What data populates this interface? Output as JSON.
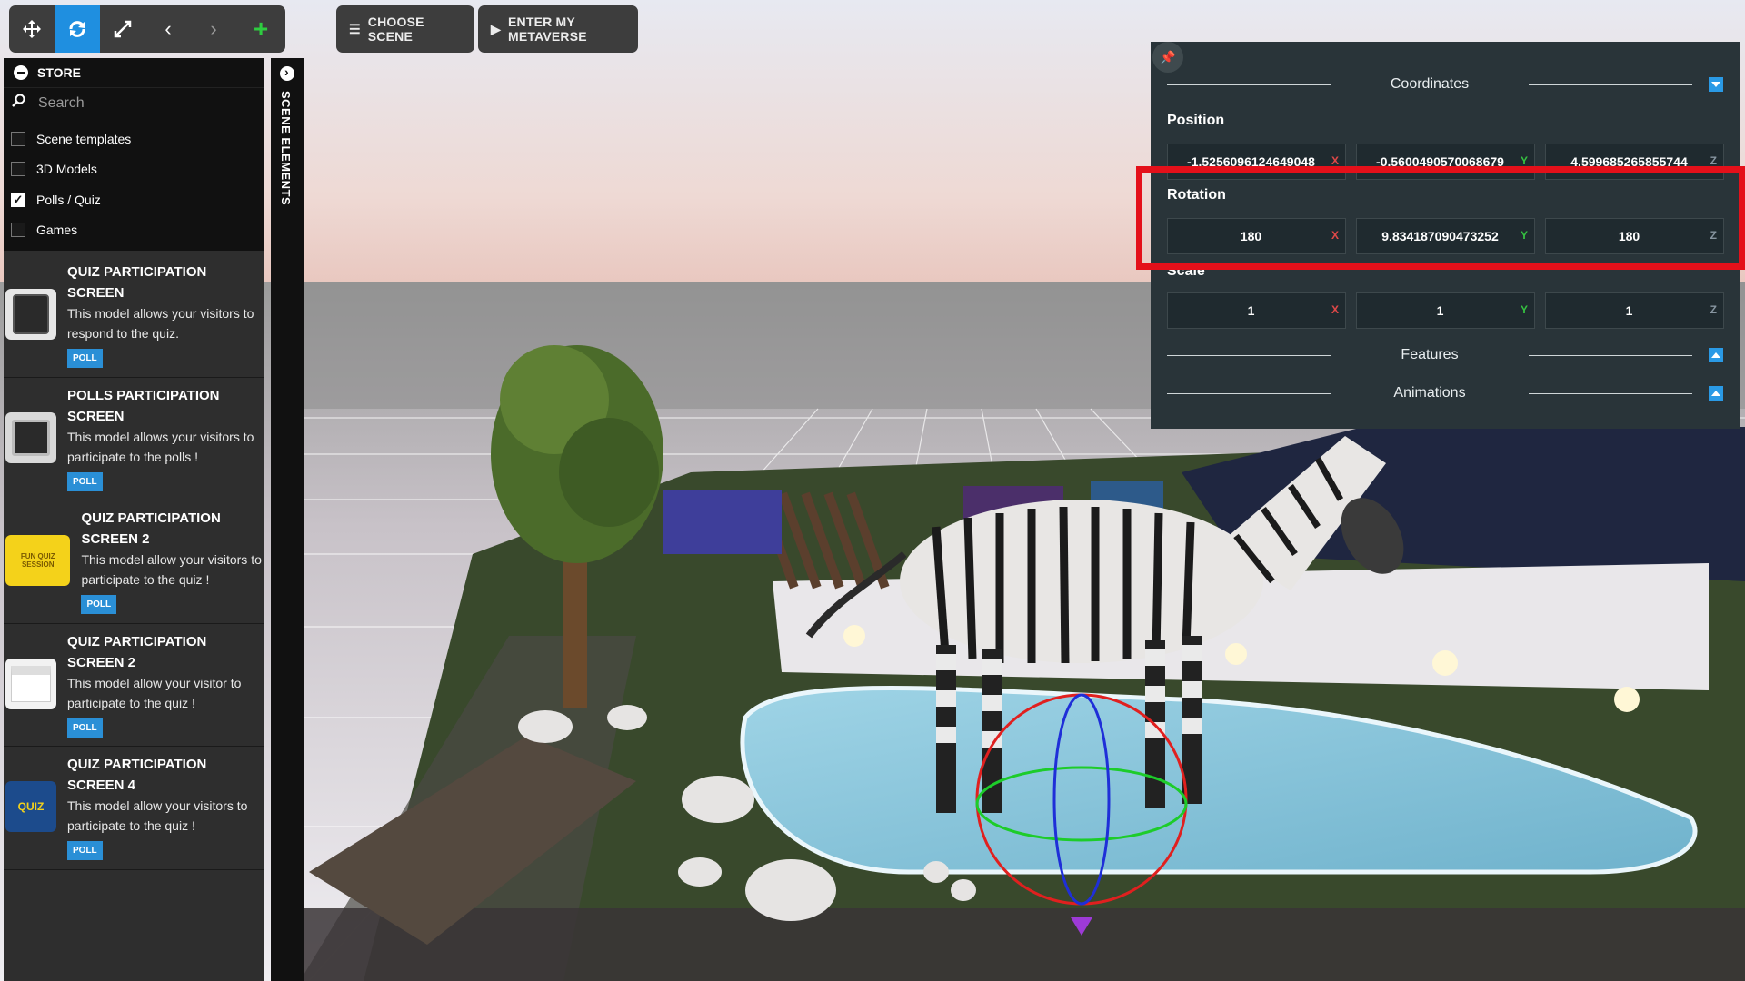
{
  "toolbar": {
    "tools": [
      "move-icon",
      "rotate-icon",
      "scale-icon",
      "undo-icon",
      "redo-icon",
      "add-icon"
    ],
    "choose_scene_label": "CHOOSE SCENE",
    "enter_metaverse_label": "ENTER MY METAVERSE"
  },
  "store": {
    "title": "STORE",
    "search_placeholder": "Search",
    "filters": [
      {
        "label": "Scene templates",
        "checked": false
      },
      {
        "label": "3D Models",
        "checked": false
      },
      {
        "label": "Polls / Quiz",
        "checked": true
      },
      {
        "label": "Games",
        "checked": false
      }
    ],
    "items": [
      {
        "title": "QUIZ PARTICIPATION SCREEN",
        "desc": "This model allows your visitors to respond to the quiz.",
        "badge": "POLL"
      },
      {
        "title": "POLLS PARTICIPATION SCREEN",
        "desc": "This model allows your visitors to participate to the polls !",
        "badge": "POLL"
      },
      {
        "title": "QUIZ PARTICIPATION SCREEN 2",
        "desc": "This model allow your visitors to participate to the quiz !",
        "badge": "POLL",
        "thumb_text": "FUN QUIZ SESSION"
      },
      {
        "title": "QUIZ PARTICIPATION SCREEN 2",
        "desc": "This model allow your visitor to participate to the quiz !",
        "badge": "POLL"
      },
      {
        "title": "QUIZ PARTICIPATION SCREEN 4",
        "desc": "This model allow your visitors to participate to the quiz !",
        "badge": "POLL",
        "thumb_text": "QUIZ"
      }
    ]
  },
  "scene_elements": {
    "label": "SCENE ELEMENTS"
  },
  "coords": {
    "title": "Coordinates",
    "position": {
      "label": "Position",
      "x": "-1.5256096124649048",
      "y": "-0.5600490570068679",
      "z": "4.599685265855744"
    },
    "rotation": {
      "label": "Rotation",
      "x": "180",
      "y": "9.834187090473252",
      "z": "180"
    },
    "scale": {
      "label": "Scale",
      "x": "1",
      "y": "1",
      "z": "1"
    },
    "axis_labels": {
      "x": "X",
      "y": "Y",
      "z": "Z"
    },
    "features_label": "Features",
    "animations_label": "Animations"
  },
  "colors": {
    "accent": "#1f8fe0",
    "highlight": "#e4101a",
    "axis_x": "#e04848",
    "axis_y": "#35c241"
  }
}
